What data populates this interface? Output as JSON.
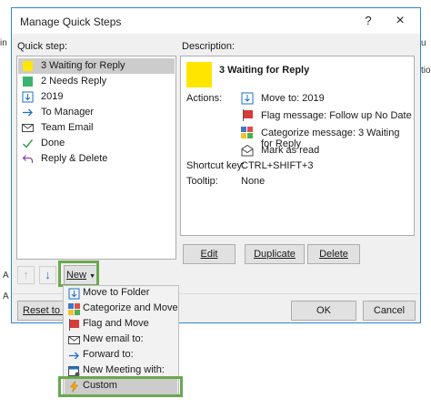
{
  "background": {
    "text_lines": [
      "in",
      "A",
      "A",
      "u",
      "tion"
    ]
  },
  "dialog": {
    "title": "Manage Quick Steps",
    "help_label": "?",
    "close_label": "×",
    "quick_step_label": "Quick step:",
    "description_label": "Description:",
    "quick_steps": [
      {
        "label": "3 Waiting for Reply",
        "icon": "yellow-category-icon",
        "selected": true
      },
      {
        "label": "2 Needs Reply",
        "icon": "green-category-icon"
      },
      {
        "label": "2019",
        "icon": "move-to-folder-icon"
      },
      {
        "label": "To Manager",
        "icon": "forward-arrow-icon"
      },
      {
        "label": "Team Email",
        "icon": "envelope-icon"
      },
      {
        "label": "Done",
        "icon": "checkmark-icon"
      },
      {
        "label": "Reply & Delete",
        "icon": "reply-arrow-icon"
      }
    ],
    "description": {
      "name": "3 Waiting for Reply",
      "actions_label": "Actions:",
      "actions": [
        {
          "label": "Move to: 2019",
          "icon": "move-to-folder-icon"
        },
        {
          "label": "Flag message: Follow up No Date",
          "icon": "flag-icon"
        },
        {
          "label": "Categorize message: 3 Waiting for Reply",
          "icon": "categorize-icon"
        },
        {
          "label": "Mark as read",
          "icon": "open-envelope-icon"
        }
      ],
      "shortcut_label": "Shortcut key:",
      "shortcut_value": "CTRL+SHIFT+3",
      "tooltip_label": "Tooltip:",
      "tooltip_value": "None"
    },
    "buttons": {
      "edit": "Edit",
      "duplicate": "Duplicate",
      "delete": "Delete",
      "new": "New",
      "reset": "Reset to De",
      "ok": "OK",
      "cancel": "Cancel"
    },
    "new_menu": [
      {
        "label": "Move to Folder",
        "icon": "move-to-folder-icon"
      },
      {
        "label": "Categorize and Move",
        "icon": "categorize-icon"
      },
      {
        "label": "Flag and Move",
        "icon": "flag-icon"
      },
      {
        "label": "New email to:",
        "icon": "envelope-icon"
      },
      {
        "label": "Forward to:",
        "icon": "forward-arrow-icon"
      },
      {
        "label": "New Meeting with:",
        "icon": "calendar-icon"
      },
      {
        "label": "Custom",
        "icon": "lightning-icon",
        "selected": true
      }
    ],
    "colors": {
      "accent": "#2b88d8",
      "highlight": "#6aa84f",
      "selection": "#cccccc",
      "yellow_category": "#ffe600"
    }
  }
}
